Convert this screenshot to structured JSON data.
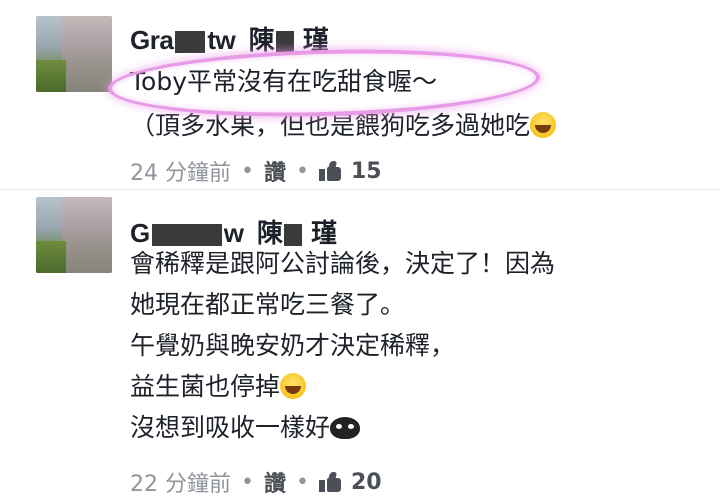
{
  "comments": [
    {
      "author": {
        "prefix": "Gra",
        "mid": "tw",
        "name1": "陳",
        "name2": "瑾"
      },
      "lines": [
        "Toby平常沒有在吃甜食喔～",
        "（頂多水果，但也是餵狗吃多過她吃"
      ],
      "time": "24 分鐘前",
      "action": "讚",
      "likes": "15",
      "separator": "•"
    },
    {
      "author": {
        "prefix": "G",
        "mid": "w",
        "name1": "陳",
        "name2": "瑾"
      },
      "lines": [
        "會稀釋是跟阿公討論後，決定了！因為",
        "她現在都正常吃三餐了。",
        "午覺奶與晚安奶才決定稀釋，",
        "益生菌也停掉",
        "沒想到吸收一樣好"
      ],
      "time": "22 分鐘前",
      "action": "讚",
      "likes": "20",
      "separator": "•"
    }
  ],
  "colors": {
    "highlight": "#e79ae6",
    "meta_text": "#90949c",
    "action_text": "#4b4f56",
    "body_text": "#1d2129"
  },
  "icons": [
    "avatar-blurred",
    "laughing-emoji",
    "devil-emoji",
    "like-icon"
  ]
}
